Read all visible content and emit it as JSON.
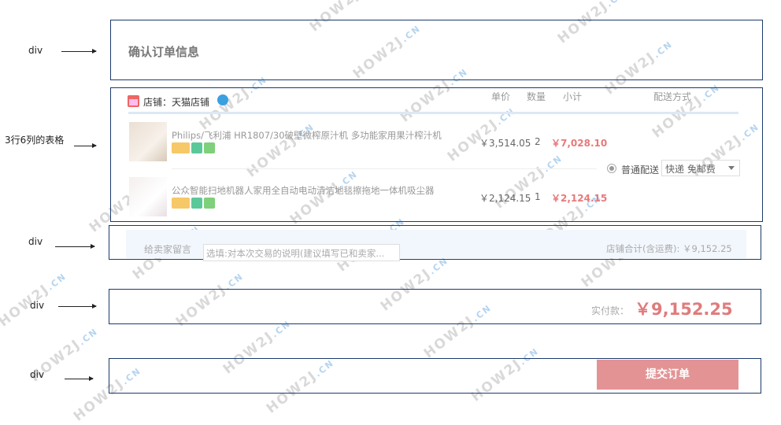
{
  "annotations": {
    "labels": [
      "div",
      "3行6列的表格",
      "div",
      "div",
      "div"
    ]
  },
  "header": {
    "title": "确认订单信息"
  },
  "order_table": {
    "shop_label": "店铺：天猫店铺",
    "columns": [
      "单价",
      "数量",
      "小计",
      "配送方式"
    ],
    "rows": [
      {
        "name": "Philips/飞利浦 HR1807/30破壁微榨原汁机 多功能家用果汁榨汁机",
        "price": "￥3,514.05",
        "qty": "2",
        "subtotal": "￥7,028.10"
      },
      {
        "name": "公众智能扫地机器人家用全自动电动清洁地毯擦拖地一体机吸尘器",
        "price": "￥2,124.15",
        "qty": "1",
        "subtotal": "￥2,124.15"
      }
    ],
    "shipping": {
      "label": "普通配送",
      "selected": "快递 免邮费"
    }
  },
  "message": {
    "label": "给卖家留言",
    "placeholder": "选填:对本次交易的说明(建议填写已和卖家...",
    "shop_total": "店铺合计(含运费): ￥9,152.25"
  },
  "payment": {
    "label": "实付款：",
    "amount": "￥9,152.25"
  },
  "submit": {
    "label": "提交订单"
  },
  "watermark": {
    "text": "HOW2J",
    "suffix": ".CN"
  },
  "colors": {
    "frame": "#1b3a6b",
    "price_red": "#e07b7c",
    "button": "#e49395"
  }
}
